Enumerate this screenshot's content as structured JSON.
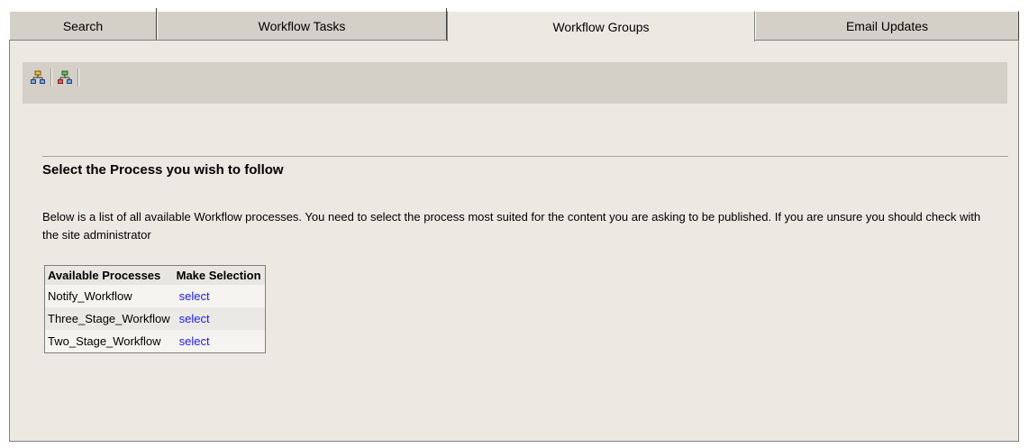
{
  "tabs": [
    {
      "label": "Search"
    },
    {
      "label": "Workflow Tasks"
    },
    {
      "label": "Workflow Groups"
    },
    {
      "label": "Email Updates"
    }
  ],
  "active_tab": "Workflow Groups",
  "toolbar": {
    "icons": [
      "workflow-tree-icon",
      "workflow-tree-color-icon"
    ]
  },
  "main": {
    "heading": "Select the Process you wish to follow",
    "description": "Below is a list of all available Workflow processes. You need to select the process most suited for the content you are asking to be published. If you are unsure you should check with the site administrator"
  },
  "table": {
    "headers": [
      "Available Processes",
      "Make Selection"
    ],
    "rows": [
      {
        "process": "Notify_Workflow",
        "action": "select"
      },
      {
        "process": "Three_Stage_Workflow",
        "action": "select"
      },
      {
        "process": "Two_Stage_Workflow",
        "action": "select"
      }
    ]
  },
  "colors": {
    "panel_bg": "#ece9e3",
    "tab_bg": "#d4d0c8",
    "link": "#1a1aff"
  }
}
